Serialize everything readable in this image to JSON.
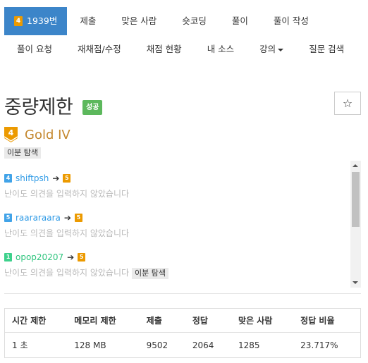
{
  "nav": {
    "problem_number": "1939번",
    "tier_level": "4",
    "row1": [
      "제출",
      "맞은 사람",
      "숏코딩",
      "풀이",
      "풀이 작성"
    ],
    "row2": [
      "풀이 요청",
      "재채점/수정",
      "채점 현황",
      "내 소스",
      "강의",
      "질문 검색"
    ]
  },
  "problem": {
    "title": "중량제한",
    "status": "성공",
    "star": "☆",
    "tier_level": "4",
    "tier_name": "Gold IV",
    "tier_color": "#ec9a00",
    "tags": [
      "이분 탐색"
    ]
  },
  "opinions": [
    {
      "level": "4",
      "level_color": "#41a3e8",
      "user": "shiftpsh",
      "user_color": "#2e9ae6",
      "arrow": "➔",
      "target_level": "5",
      "text": "난이도 의견을 입력하지 않았습니다",
      "tag": ""
    },
    {
      "level": "5",
      "level_color": "#41a3e8",
      "user": "raararaara",
      "user_color": "#2e9ae6",
      "arrow": "➔",
      "target_level": "5",
      "text": "난이도 의견을 입력하지 않았습니다",
      "tag": ""
    },
    {
      "level": "1",
      "level_color": "#3dd18c",
      "user": "opop20207",
      "user_color": "#2fc57e",
      "arrow": "➔",
      "target_level": "5",
      "text": "난이도 의견을 입력하지 않았습니다",
      "tag": "이분 탐색"
    }
  ],
  "stats": {
    "headers": [
      "시간 제한",
      "메모리 제한",
      "제출",
      "정답",
      "맞은 사람",
      "정답 비율"
    ],
    "row": [
      "1 초",
      "128 MB",
      "9502",
      "2064",
      "1285",
      "23.717%"
    ]
  }
}
